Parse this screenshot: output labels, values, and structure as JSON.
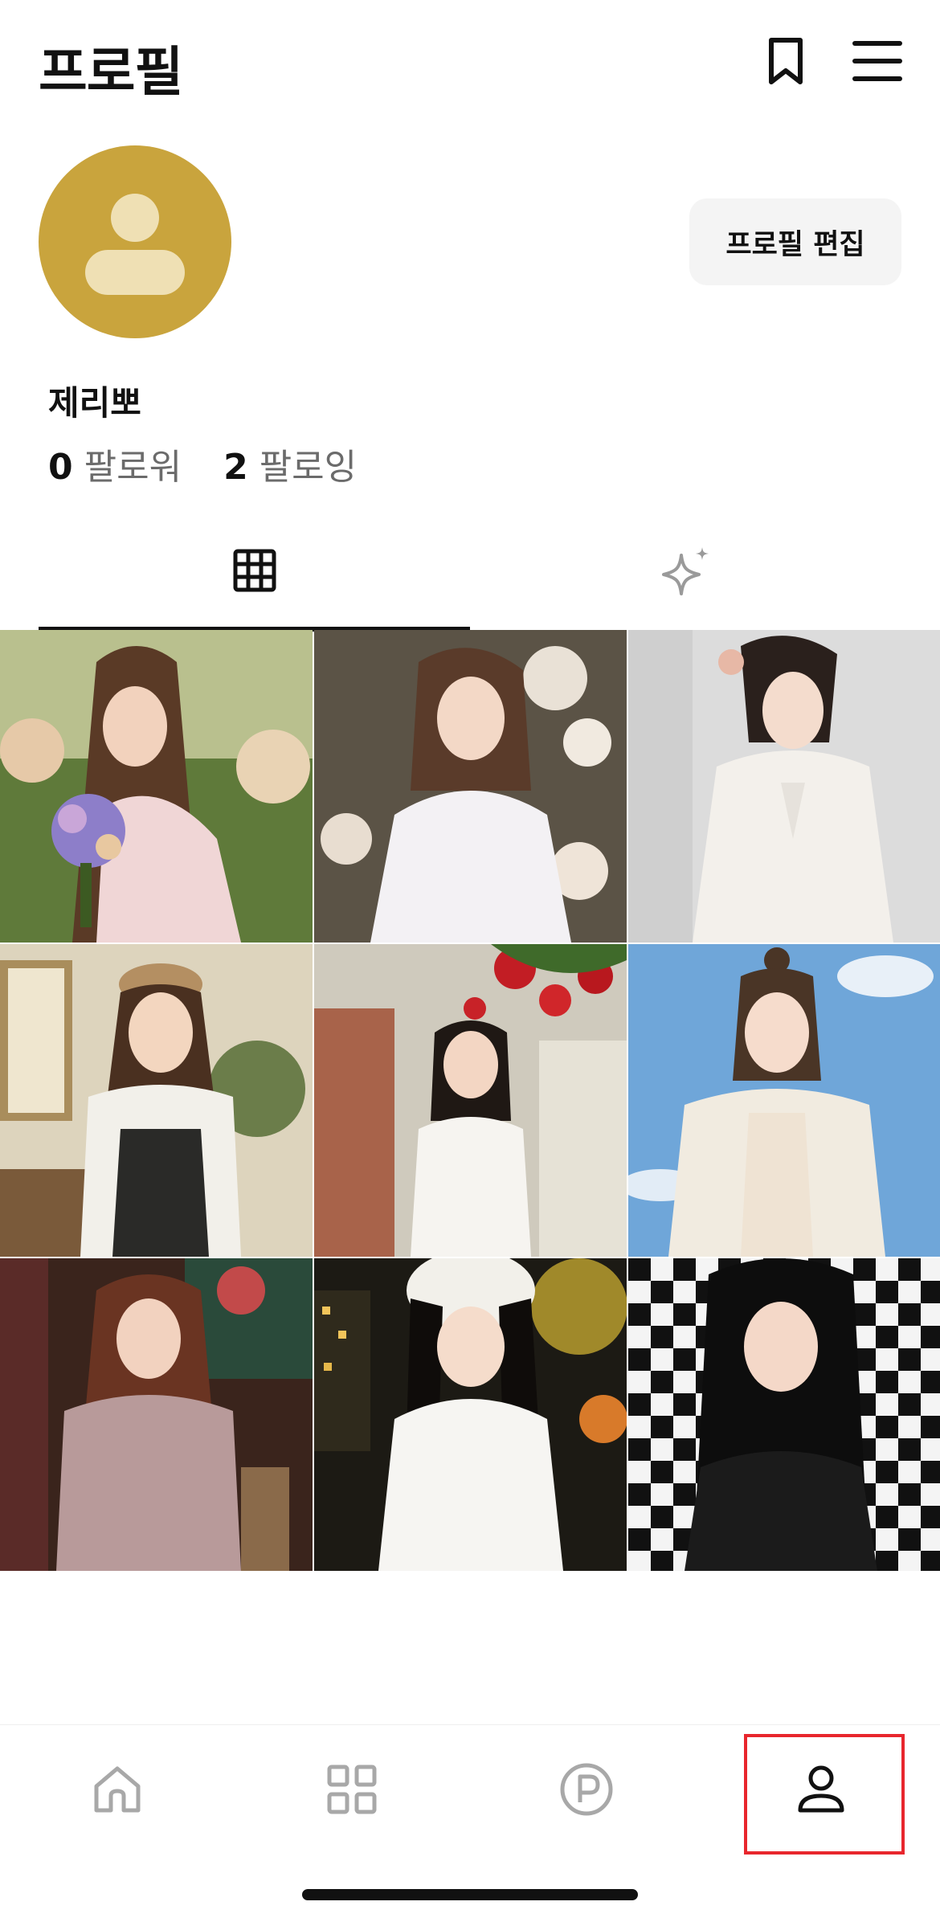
{
  "header": {
    "title": "프로필",
    "icons": [
      "bookmark-icon",
      "menu-icon"
    ]
  },
  "profile": {
    "avatar_color": "#c9a43d",
    "edit_button_label": "프로필 편집",
    "username": "제리뽀",
    "followers_count": "0",
    "followers_label": "팔로워",
    "following_count": "2",
    "following_label": "팔로잉"
  },
  "tabs": [
    {
      "icon": "grid-icon",
      "active": true
    },
    {
      "icon": "sparkle-icon",
      "active": false
    }
  ],
  "photos": [
    {
      "name": "photo-woman-bouquet-garden"
    },
    {
      "name": "photo-woman-white-dress-roses"
    },
    {
      "name": "photo-woman-hanbok"
    },
    {
      "name": "photo-woman-beret-overalls"
    },
    {
      "name": "photo-woman-red-roses-alley"
    },
    {
      "name": "photo-woman-blue-sky"
    },
    {
      "name": "photo-woman-shirt-dark-room"
    },
    {
      "name": "photo-woman-white-beanie-night"
    },
    {
      "name": "photo-woman-checker-pattern"
    }
  ],
  "bottom_nav": {
    "items": [
      "home-icon",
      "feed-icon",
      "point-icon",
      "profile-icon"
    ],
    "highlight_color": "#e8262d"
  }
}
